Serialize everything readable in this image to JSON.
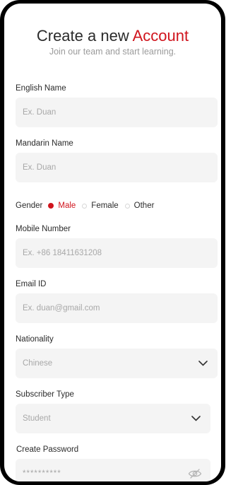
{
  "header": {
    "title_prefix": "Create a new",
    "title_accent": "Account",
    "subtitle": "Join our team and start learning."
  },
  "form": {
    "english_name": {
      "label": "English Name",
      "placeholder": "Ex. Duan"
    },
    "mandarin_name": {
      "label": "Mandarin Name",
      "placeholder": "Ex. Duan"
    },
    "gender": {
      "label": "Gender",
      "options": [
        "Male",
        "Female",
        "Other"
      ],
      "selected": "Male"
    },
    "mobile": {
      "label": "Mobile Number",
      "placeholder": "Ex. +86 18411631208"
    },
    "email": {
      "label": "Email ID",
      "placeholder": "Ex. duan@gmail.com"
    },
    "nationality": {
      "label": "Nationality",
      "value": "Chinese"
    },
    "subscriber_type": {
      "label": "Subscriber Type",
      "value": "Student"
    },
    "password": {
      "label": "Create Password",
      "placeholder": "**********"
    }
  },
  "colors": {
    "accent": "#d0141d",
    "field_bg": "#f4f4f4",
    "placeholder": "#a8a8a8",
    "frame": "#000000"
  },
  "icons": {
    "dropdown": "chevron-down-icon",
    "password_toggle": "eye-off-icon"
  }
}
